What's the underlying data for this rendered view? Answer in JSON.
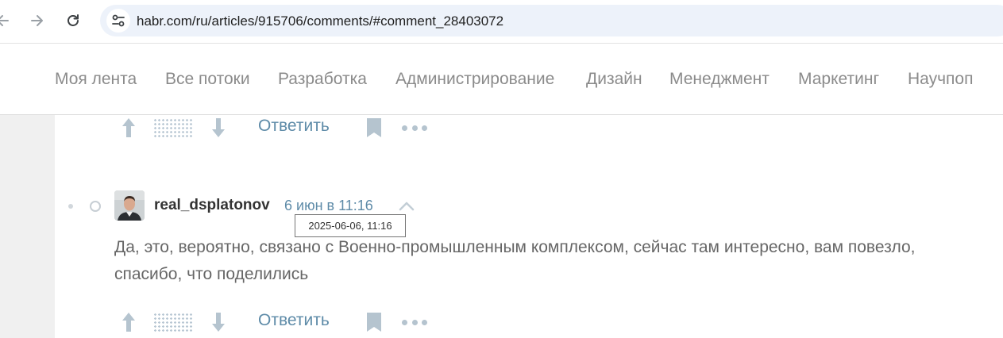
{
  "browser": {
    "url": "habr.com/ru/articles/915706/comments/#comment_28403072",
    "icons": {
      "back": "arrow-left-icon",
      "forward": "arrow-right-icon",
      "reload": "reload-icon",
      "site_info": "tune-icon"
    }
  },
  "site_nav": {
    "items": [
      "Моя лента",
      "Все потоки",
      "Разработка",
      "Администрирование",
      "Дизайн",
      "Менеджмент",
      "Маркетинг",
      "Научпоп"
    ]
  },
  "previous_comment_actions": {
    "reply_label": "Ответить"
  },
  "comment": {
    "author": "real_dsplatonov",
    "time": "6 июн в 11:16",
    "tooltip": "2025-06-06, 11:16",
    "text": "Да, это, вероятно, связано с Военно-промышленным комплексом, сейчас там интересно, вам повезло, спасибо, что поделились",
    "reply_label": "Ответить"
  },
  "colors": {
    "link": "#5e8ba8",
    "action_icon": "#b5c4cf",
    "nav_text": "#8b8b8b",
    "gutter": "#f0f0f0"
  }
}
